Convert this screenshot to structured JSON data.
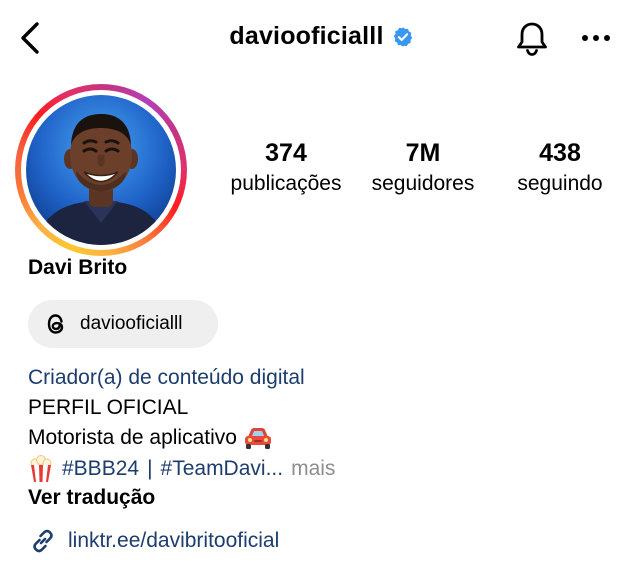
{
  "header": {
    "username": "daviooficialll",
    "verified": true,
    "icons": {
      "back": "chevron-left-icon",
      "notifications": "bell-icon",
      "more": "more-horizontal-icon"
    }
  },
  "profile": {
    "display_name": "Davi Brito",
    "avatar": "profile-photo",
    "story_ring_colors": [
      "#fdc830",
      "#f77737",
      "#fd1d1d",
      "#e1306c",
      "#c13584"
    ]
  },
  "stats": {
    "posts": {
      "value": "374",
      "label": "publicações"
    },
    "followers": {
      "value": "7M",
      "label": "seguidores"
    },
    "following": {
      "value": "438",
      "label": "seguindo"
    }
  },
  "threads": {
    "icon": "threads-icon",
    "handle": "daviooficialll"
  },
  "bio": {
    "category": "Criador(a) de conteúdo digital",
    "line1": "PERFIL OFICIAL",
    "line2": "Motorista de aplicativo",
    "line2_emoji": "car-emoji",
    "line3_emoji": "popcorn-emoji",
    "hashtag1": "#BBB24",
    "separator": "|",
    "hashtag2": "#TeamDavi...",
    "more": "mais",
    "translate": "Ver tradução"
  },
  "link": {
    "icon": "link-icon",
    "url": "linktr.ee/davibritooficial"
  },
  "colors": {
    "link": "#1c3d6e",
    "verified": "#3897f0",
    "muted": "#8e8e8e",
    "pill": "#efefef"
  }
}
